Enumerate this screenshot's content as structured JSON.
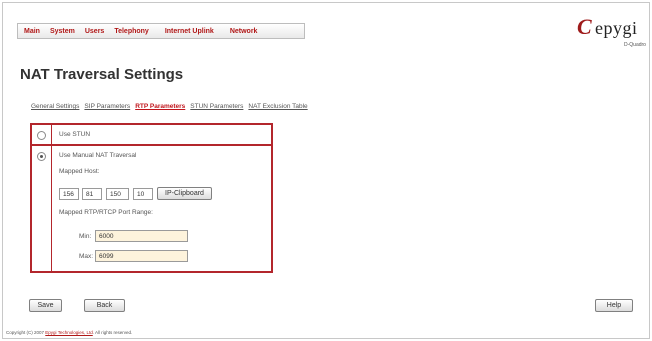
{
  "nav": {
    "items": [
      "Main",
      "System",
      "Users",
      "Telephony",
      "Internet Uplink",
      "Network"
    ]
  },
  "logo": {
    "brand": "epygi",
    "tagline": "D-Quadro"
  },
  "page": {
    "title": "NAT Traversal Settings"
  },
  "tabs": [
    {
      "label": "General Settings",
      "active": false
    },
    {
      "label": "SIP Parameters",
      "active": false
    },
    {
      "label": "RTP Parameters",
      "active": true
    },
    {
      "label": "STUN Parameters",
      "active": false
    },
    {
      "label": "NAT Exclusion Table",
      "active": false
    }
  ],
  "form": {
    "use_stun_label": "Use STUN",
    "use_stun_selected": false,
    "manual_label": "Use Manual NAT Traversal",
    "manual_selected": true,
    "mapped_host_label": "Mapped Host:",
    "mapped_host": [
      "156",
      "81",
      "150",
      "10"
    ],
    "ip_clipboard_label": "IP-Clipboard",
    "port_range_label": "Mapped RTP/RTCP Port Range:",
    "min_label": "Min:",
    "min_value": "6000",
    "max_label": "Max:",
    "max_value": "6099"
  },
  "actions": {
    "save": "Save",
    "back": "Back",
    "help": "Help"
  },
  "footer": {
    "prefix": "Copyright (C) 2007",
    "company": "Epygi Technologies, Ltd",
    "suffix": ". All rights reserved."
  },
  "colors": {
    "accent": "#b3262c",
    "link_active": "#c0141b",
    "input_bg": "#fdf3dc"
  }
}
